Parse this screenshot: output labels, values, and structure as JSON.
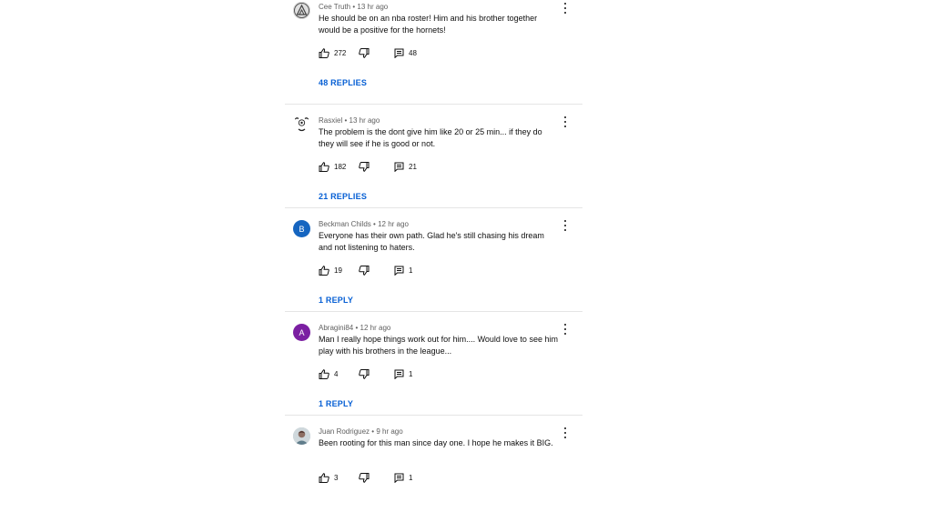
{
  "comments": [
    {
      "author": "Cee Truth",
      "time": "13 hr ago",
      "separator": "•",
      "text": "He should be on an nba roster! Him and his brother together would be a positive for the hornets!",
      "likes": "272",
      "replies": "48",
      "replies_label": "48 REPLIES",
      "avatar": {
        "type": "icon",
        "icon": "triangle-logo-icon",
        "bg": "#9e9e9e"
      }
    },
    {
      "author": "Rasxiel",
      "time": "13 hr ago",
      "separator": "•",
      "text": "The problem is the dont give him like 20 or 25 min... if they do they will see if he is good or not.",
      "likes": "182",
      "replies": "21",
      "replies_label": "21 REPLIES",
      "avatar": {
        "type": "icon",
        "icon": "soccer-ball-icon",
        "bg": "#ffffff"
      }
    },
    {
      "author": "Beckman Childs",
      "time": "12 hr ago",
      "separator": "•",
      "text": "Everyone has their own path. Glad he's still chasing his dream and not listening to haters.",
      "likes": "19",
      "replies": "1",
      "replies_label": "1 REPLY",
      "avatar": {
        "type": "letter",
        "letter": "B",
        "bg": "#1565c0"
      }
    },
    {
      "author": "Abragini84",
      "time": "12 hr ago",
      "separator": "•",
      "text": "Man I really hope things work out for him.... Would love to see him play with his brothers in the league...",
      "likes": "4",
      "replies": "1",
      "replies_label": "1 REPLY",
      "avatar": {
        "type": "letter",
        "letter": "A",
        "bg": "#7b1fa2"
      }
    },
    {
      "author": "Juan Rodriguez",
      "time": "9 hr ago",
      "separator": "•",
      "text": "Been rooting for this man since day one. I hope he makes it BIG.",
      "likes": "3",
      "replies": "1",
      "avatar": {
        "type": "icon",
        "icon": "profile-photo-icon",
        "bg": "#b0bec5"
      }
    }
  ],
  "colors": {
    "link": "#065fd4",
    "meta": "#606060",
    "divider": "#e5e5e5"
  },
  "icons": {
    "like": "thumb-up-icon",
    "dislike": "thumb-down-icon",
    "reply": "reply-comment-icon",
    "menu": "more-vert-icon"
  }
}
